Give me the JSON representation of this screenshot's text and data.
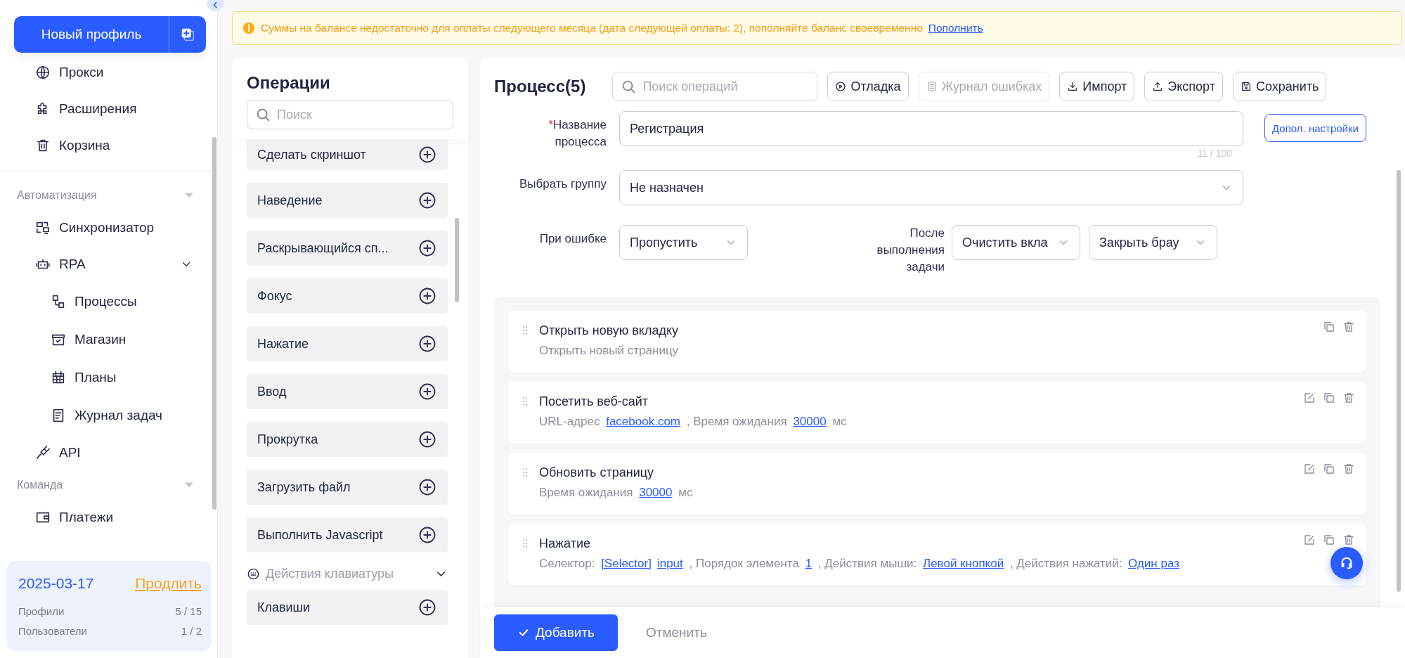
{
  "sidebar": {
    "new_profile_button": "Новый профиль",
    "items": [
      {
        "label": "Прокси"
      },
      {
        "label": "Расширения"
      },
      {
        "label": "Корзина"
      }
    ],
    "sections": [
      {
        "title": "Автоматизация",
        "expanded": true,
        "items": [
          {
            "label": "Синхронизатор"
          },
          {
            "label": "RPA",
            "expanded": true,
            "children": [
              {
                "label": "Процессы"
              },
              {
                "label": "Магазин"
              },
              {
                "label": "Планы"
              },
              {
                "label": "Журнал задач"
              }
            ]
          },
          {
            "label": "API"
          }
        ]
      },
      {
        "title": "Команда",
        "expanded": true,
        "items": [
          {
            "label": "Платежи"
          }
        ]
      }
    ],
    "plan": {
      "date": "2025-03-17",
      "renew_link": "Продлить",
      "stats": [
        {
          "label": "Профили",
          "value": "5 / 15"
        },
        {
          "label": "Пользователи",
          "value": "1 / 2"
        }
      ]
    }
  },
  "banner": {
    "text": "Суммы на балансе недостаточно для оплаты следующего месяца (дата следующей оплаты: 2), пополняйте баланс своевременно",
    "link": "Пополнить"
  },
  "operations": {
    "title": "Операции",
    "search": {
      "placeholder": "Поиск"
    },
    "items": [
      {
        "label": "Сделать скриншот"
      },
      {
        "label": "Наведение"
      },
      {
        "label": "Раскрывающийся сп..."
      },
      {
        "label": "Фокус"
      },
      {
        "label": "Нажатие"
      },
      {
        "label": "Ввод"
      },
      {
        "label": "Прокрутка"
      },
      {
        "label": "Загрузить файл"
      },
      {
        "label": "Выполнить Javascript"
      }
    ],
    "sections": [
      {
        "title": "Действия клавиатуры",
        "expanded": true,
        "items": [
          {
            "label": "Клавиши"
          }
        ]
      }
    ]
  },
  "process": {
    "title": "Процесс(5)",
    "search": {
      "placeholder": "Поиск операций"
    },
    "toolbar": [
      {
        "label": "Отладка",
        "disabled": false
      },
      {
        "label": "Журнал ошибках",
        "disabled": true
      },
      {
        "label": "Импорт",
        "disabled": false
      },
      {
        "label": "Экспорт",
        "disabled": false
      },
      {
        "label": "Сохранить",
        "disabled": false
      }
    ],
    "form": {
      "name": {
        "label": "Название процесса",
        "required": true,
        "required_mark": "*",
        "value": "Регистрация",
        "counter": "11 / 100",
        "extra_button": "Допол. настройки"
      },
      "group": {
        "label": "Выбрать группу",
        "value": "Не назначен"
      },
      "on_error": {
        "label": "При ошибке",
        "value": "Пропустить"
      },
      "after": {
        "label": "После выполнения задачи",
        "values": [
          "Очистить вкла",
          "Закрыть брау"
        ]
      }
    },
    "steps": [
      {
        "title": "Открыть новую вкладку",
        "editable": false,
        "details": [
          {
            "kind": "text",
            "text": "Открыть новый страницу"
          }
        ]
      },
      {
        "title": "Посетить веб-сайт",
        "editable": true,
        "details": [
          {
            "kind": "text",
            "text": "URL-адрес "
          },
          {
            "kind": "link",
            "text": "facebook.com"
          },
          {
            "kind": "text",
            "text": " , Время ожидания "
          },
          {
            "kind": "link",
            "text": "30000"
          },
          {
            "kind": "text",
            "text": " мс"
          }
        ]
      },
      {
        "title": "Обновить страницу",
        "editable": true,
        "details": [
          {
            "kind": "text",
            "text": "Время ожидания "
          },
          {
            "kind": "link",
            "text": "30000"
          },
          {
            "kind": "text",
            "text": " мс"
          }
        ]
      },
      {
        "title": "Нажатие",
        "editable": true,
        "details": [
          {
            "kind": "text",
            "text": "Селектор: "
          },
          {
            "kind": "link",
            "text": "[Selector]"
          },
          {
            "kind": "link",
            "text": "input"
          },
          {
            "kind": "text",
            "text": " , Порядок элемента "
          },
          {
            "kind": "link",
            "text": "1"
          },
          {
            "kind": "text",
            "text": " , Действия мыши: "
          },
          {
            "kind": "link",
            "text": "Левой кнопкой"
          },
          {
            "kind": "text",
            "text": " , Действия нажатий: "
          },
          {
            "kind": "link",
            "text": "Один раз"
          }
        ]
      }
    ],
    "footer": {
      "add_button": "Добавить",
      "cancel_button": "Отменить"
    }
  }
}
